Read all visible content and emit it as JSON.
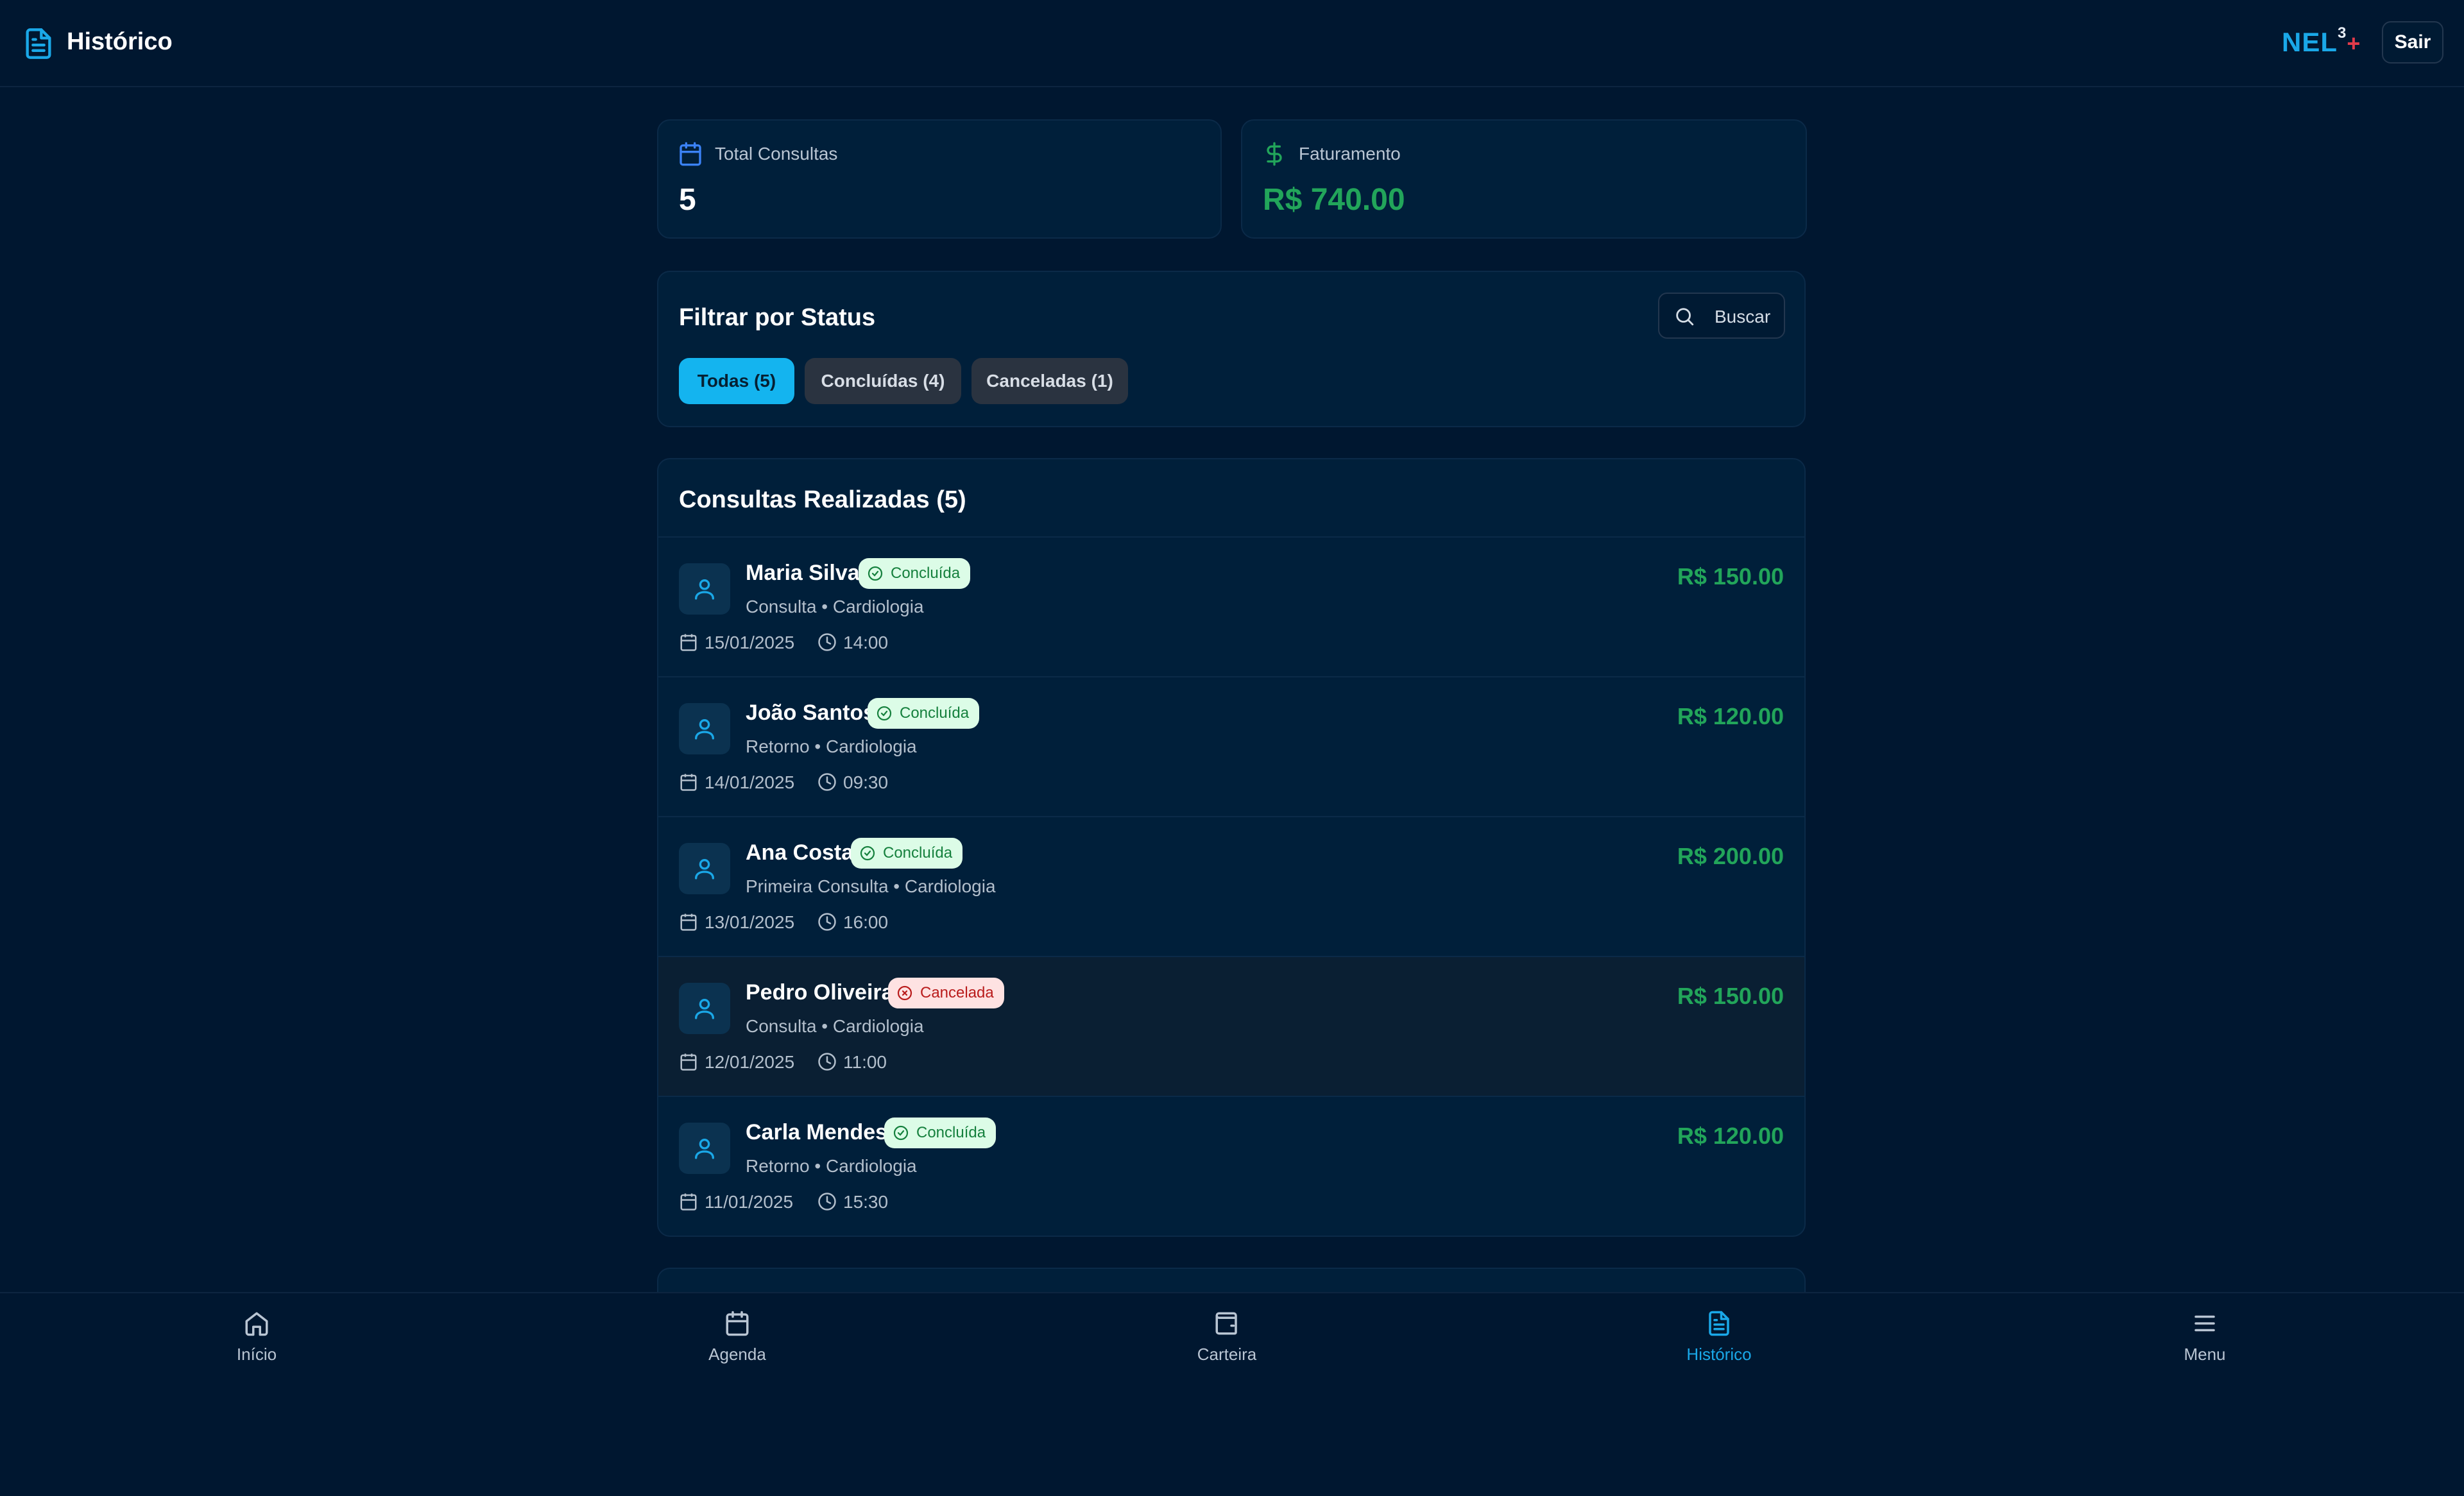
{
  "header": {
    "title": "Histórico",
    "logo_text": "NEL",
    "logo_sup": "3",
    "logo_plus": "+",
    "logout_label": "Sair"
  },
  "stats": {
    "total": {
      "label": "Total Consultas",
      "value": "5",
      "icon": "calendar-icon"
    },
    "revenue": {
      "label": "Faturamento",
      "value": "R$ 740.00",
      "icon": "dollar-icon"
    }
  },
  "filter": {
    "title": "Filtrar por Status",
    "search_label": "Buscar",
    "chips": [
      {
        "label": "Todas (5)",
        "active": true
      },
      {
        "label": "Concluídas (4)",
        "active": false
      },
      {
        "label": "Canceladas (1)",
        "active": false
      }
    ]
  },
  "list": {
    "title": "Consultas Realizadas (5)",
    "items": [
      {
        "name": "Maria Silva",
        "status": "Concluída",
        "status_type": "ok",
        "type": "Consulta • Cardiologia",
        "date": "15/01/2025",
        "time": "14:00",
        "price": "R$ 150.00"
      },
      {
        "name": "João Santos",
        "status": "Concluída",
        "status_type": "ok",
        "type": "Retorno • Cardiologia",
        "date": "14/01/2025",
        "time": "09:30",
        "price": "R$ 120.00"
      },
      {
        "name": "Ana Costa",
        "status": "Concluída",
        "status_type": "ok",
        "type": "Primeira Consulta • Cardiologia",
        "date": "13/01/2025",
        "time": "16:00",
        "price": "R$ 200.00"
      },
      {
        "name": "Pedro Oliveira",
        "status": "Cancelada",
        "status_type": "cancel",
        "type": "Consulta • Cardiologia",
        "date": "12/01/2025",
        "time": "11:00",
        "price": "R$ 150.00"
      },
      {
        "name": "Carla Mendes",
        "status": "Concluída",
        "status_type": "ok",
        "type": "Retorno • Cardiologia",
        "date": "11/01/2025",
        "time": "15:30",
        "price": "R$ 120.00"
      }
    ]
  },
  "nav": {
    "items": [
      {
        "label": "Início",
        "icon": "home-icon"
      },
      {
        "label": "Agenda",
        "icon": "calendar-icon"
      },
      {
        "label": "Carteira",
        "icon": "wallet-icon"
      },
      {
        "label": "Histórico",
        "icon": "document-icon",
        "active": true
      },
      {
        "label": "Menu",
        "icon": "menu-icon"
      }
    ]
  },
  "colors": {
    "background": "#001730",
    "accent": "#14b4ef",
    "money": "#22a55a",
    "cancel": "#b91c1c"
  }
}
